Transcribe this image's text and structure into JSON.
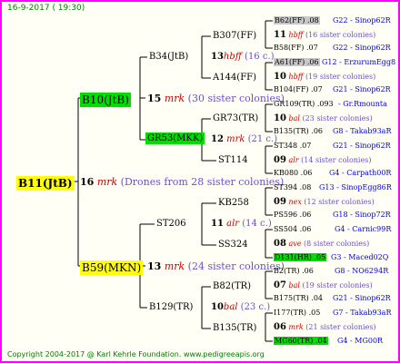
{
  "header": {
    "date": "16-9-2017 ( 19:30)"
  },
  "footer": {
    "copyright": "Copyright 2004-2017 @ Karl Kehrle Foundation.   www.pedigreeapis.org"
  },
  "colors": {
    "frame": "#ff00ff",
    "lines": "#000000",
    "header_text": "#008000",
    "mark": "#cc0000",
    "sister": "#6b4fc8",
    "link": "#0000dd",
    "yellow": "#ffff00",
    "green": "#00dd00",
    "grey": "#c8c8c8"
  },
  "root": {
    "id": "B11(JtB)",
    "num": "16",
    "mark": "mrk",
    "note": "(Drones from 28 sister colonies)"
  },
  "gen1": {
    "upper": {
      "id": "B10(JtB)",
      "num": "15",
      "mark": "mrk",
      "note": "(30 sister colonies)"
    },
    "lower": {
      "id": "B59(MKN)",
      "num": "13",
      "mark": "mrk",
      "note": "(24 sister colonies)"
    }
  },
  "gen2": [
    {
      "id": "B34(JtB)",
      "num": "13",
      "mark": "hbff",
      "note": "(16 c.)"
    },
    {
      "id": "GR53(MKK)",
      "num": "12",
      "mark": "mrk",
      "note": "(21 c.)"
    },
    {
      "id": "ST206",
      "num": "11",
      "mark": "alr",
      "note": "(14 c.)"
    },
    {
      "id": "B129(TR)",
      "num": "10",
      "mark": "bal",
      "note": "(23 c.)"
    }
  ],
  "gen3": [
    {
      "id": "B307(FF)"
    },
    {
      "id": "A144(FF)"
    },
    {
      "id": "GR73(TR)"
    },
    {
      "id": "ST114"
    },
    {
      "id": "KB258"
    },
    {
      "id": "SS324"
    },
    {
      "id": "B82(TR)"
    },
    {
      "id": "B135(TR)"
    }
  ],
  "gen4": [
    {
      "top": "B62(FF) .08",
      "top_link": "G22 - Sinop62R",
      "num": "11",
      "mark": "hbff",
      "note": "(16 sister colonies)",
      "bottom": "B58(FF) .07",
      "bottom_link": "G22 - Sinop62R"
    },
    {
      "top": "A61(FF) .06",
      "top_link": "G12 - ErzurumEgg8",
      "num": "10",
      "mark": "hbff",
      "note": "(19 sister colonies)",
      "bottom": "B104(FF) .07",
      "bottom_link": "G21 - Sinop62R"
    },
    {
      "top": "GR109(TR) .093",
      "top_link": "- Gr.Rmounta",
      "num": "10",
      "mark": "bal",
      "note": "(23 sister colonies)",
      "bottom": "B135(TR) .06",
      "bottom_link": "G8 - Takab93aR"
    },
    {
      "top": "ST348 .07",
      "top_link": "G21 - Sinop62R",
      "num": "09",
      "mark": "alr",
      "note": "(14 sister colonies)",
      "bottom": "KB080 .06",
      "bottom_link": "G4 - Carpath00R"
    },
    {
      "top": "ST394 .08",
      "top_link": "G13 - SinopEgg86R",
      "num": "09",
      "mark": "nex",
      "note": "(12 sister colonies)",
      "bottom": "PS596 .06",
      "bottom_link": "G18 - Sinop72R"
    },
    {
      "top": "SS504 .06",
      "top_link": "G4 - Carnic99R",
      "num": "08",
      "mark": "ave",
      "note": "(8 sister colonies)",
      "bottom": "D131(HR) .05",
      "bottom_link": "G3 - Maced02Q"
    },
    {
      "top": "B2(TR) .06",
      "top_link": "G8 - NO6294R",
      "num": "07",
      "mark": "bal",
      "note": "(19 sister colonies)",
      "bottom": "B175(TR) .04",
      "bottom_link": "G21 - Sinop62R"
    },
    {
      "top": "I177(TR) .05",
      "top_link": "G7 - Takab93aR",
      "num": "06",
      "mark": "mrk",
      "note": "(21 sister colonies)",
      "bottom": "MG60(TR) .04",
      "bottom_link": "G4 - MG00R"
    }
  ]
}
